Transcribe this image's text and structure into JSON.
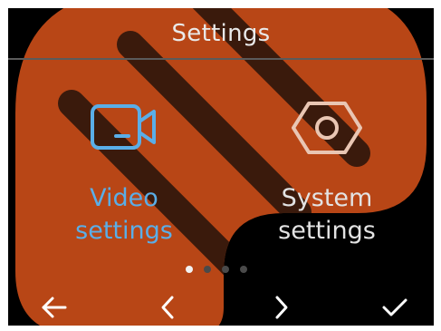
{
  "header": {
    "title": "Settings"
  },
  "tiles": [
    {
      "label": "Video\nsettings",
      "icon": "video-camera-icon",
      "state": "selected",
      "color": "#5aaee8"
    },
    {
      "label": "System\nsettings",
      "icon": "hexagon-nut-icon",
      "state": "normal",
      "color": "#e9c6b3"
    }
  ],
  "pager": {
    "page_count": 4,
    "current_page": 1
  },
  "navbar": {
    "buttons": [
      {
        "icon": "arrow-left-icon",
        "action": "back"
      },
      {
        "icon": "chevron-left-icon",
        "action": "previous"
      },
      {
        "icon": "chevron-right-icon",
        "action": "next"
      },
      {
        "icon": "checkmark-icon",
        "action": "confirm"
      }
    ]
  },
  "colors": {
    "background": "#000000",
    "accent": "#5aaee8",
    "watermark": "#b84616"
  }
}
